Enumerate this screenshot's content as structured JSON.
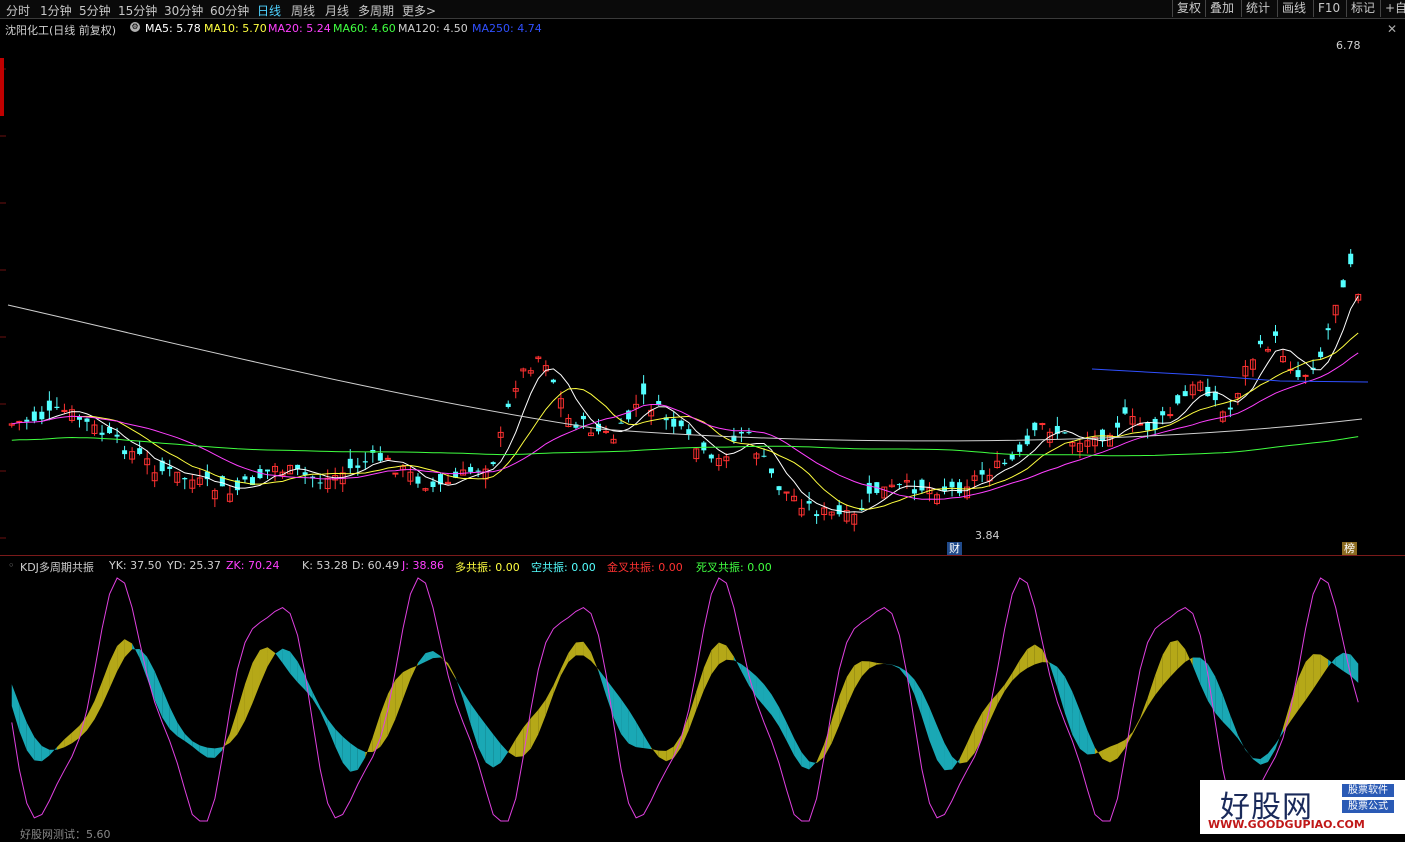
{
  "toolbar": {
    "periods": [
      "分时",
      "1分钟",
      "5分钟",
      "15分钟",
      "30分钟",
      "60分钟",
      "日线",
      "周线",
      "月线",
      "多周期",
      "更多>"
    ],
    "active_period": "日线",
    "right_buttons": [
      "复权",
      "叠加",
      "统计",
      "画线",
      "F10",
      "标记",
      "+自选"
    ]
  },
  "main_panel": {
    "stock_title": "沈阳化工(日线 前复权)",
    "gear_icon": "gear-icon",
    "ma": [
      {
        "label": "MA5: 5.78",
        "color": "#ffffff"
      },
      {
        "label": "MA10: 5.70",
        "color": "#ffff40"
      },
      {
        "label": "MA20: 5.24",
        "color": "#ff40ff"
      },
      {
        "label": "MA60: 4.60",
        "color": "#40ff40"
      },
      {
        "label": "MA120: 4.50",
        "color": "#d0d0d0"
      },
      {
        "label": "MA250: 4.74",
        "color": "#3050ff"
      }
    ],
    "high_label": "6.78",
    "low_label": "3.84",
    "badge_cai": "财",
    "badge_bang": "榜",
    "colors": {
      "up": "#ff3232",
      "down": "#54ffff",
      "ma5": "#ffffff",
      "ma10": "#ffff40",
      "ma20": "#ff40ff",
      "ma60": "#40ff40",
      "ma120": "#d0d0d0",
      "ma250": "#3050ff"
    }
  },
  "indicator_panel": {
    "name": "KDJ多周期共振",
    "fields": [
      {
        "label": "YK: 37.50",
        "color": "#d0d0d0"
      },
      {
        "label": "YD: 25.37",
        "color": "#d0d0d0"
      },
      {
        "label": "ZK: 70.24",
        "color": "#ff40ff"
      },
      {
        "label": "K: 53.28",
        "color": "#d0d0d0"
      },
      {
        "label": "D: 60.49",
        "color": "#d0d0d0"
      },
      {
        "label": "J: 38.86",
        "color": "#ff40ff"
      },
      {
        "label": "多共振: 0.00",
        "color": "#ffff40"
      },
      {
        "label": "空共振: 0.00",
        "color": "#54ffff"
      },
      {
        "label": "金叉共振: 0.00",
        "color": "#ff3232"
      },
      {
        "label": "死叉共振: 0.00",
        "color": "#40ff40"
      }
    ],
    "colors": {
      "bull": "#b5a818",
      "bear": "#1aa8b5",
      "j": "#e040e0"
    }
  },
  "watermark": {
    "big": "好股网",
    "tag1": "股票软件",
    "tag2": "股票公式",
    "url": "WWW.GOODGUPIAO.COM"
  },
  "bottom_text": "好股网测试：5.60"
}
